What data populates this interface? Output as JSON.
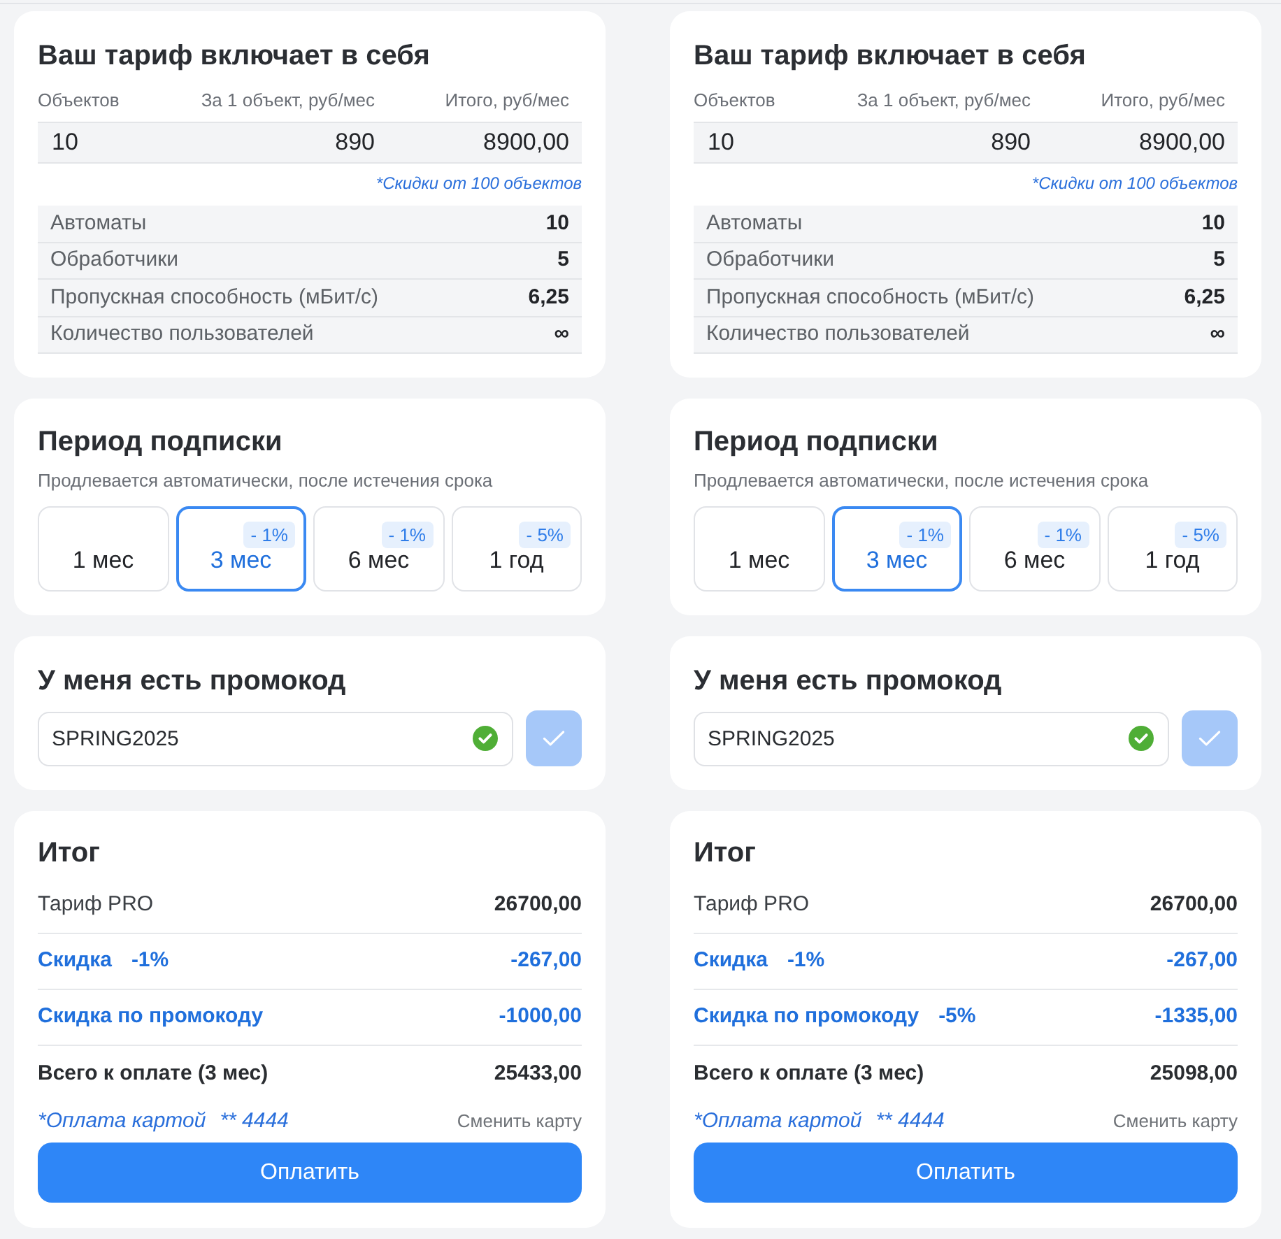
{
  "panels": [
    {
      "tariff": {
        "title": "Ваш тариф включает в себя",
        "columns": [
          "Объектов",
          "За 1 объект, руб/мес",
          "Итого, руб/мес"
        ],
        "values": [
          "10",
          "890",
          "8900,00"
        ],
        "note": "*Скидки от 100 объектов",
        "features": [
          {
            "label": "Автоматы",
            "value": "10"
          },
          {
            "label": "Обработчики",
            "value": "5"
          },
          {
            "label": "Пропускная способность (мБит/с)",
            "value": "6,25"
          },
          {
            "label": "Количество пользователей",
            "value": "∞"
          }
        ]
      },
      "period": {
        "title": "Период подписки",
        "subtitle": "Продлевается автоматически, после истечения срока",
        "options": [
          {
            "label": "1 мес",
            "selected": false
          },
          {
            "label": "3 мес",
            "discount": "- 1%",
            "selected": true
          },
          {
            "label": "6 мес",
            "discount": "- 1%",
            "selected": false
          },
          {
            "label": "1 год",
            "discount": "- 5%",
            "selected": false
          }
        ]
      },
      "promo": {
        "title": "У меня есть промокод",
        "value": "SPRING2025",
        "valid": true,
        "apply_disabled": true
      },
      "summary": {
        "title": "Итог",
        "lines": [
          {
            "kind": "base",
            "label": "Тариф PRO",
            "amount": "26700,00"
          },
          {
            "kind": "discount",
            "label": "Скидка",
            "percent": "-1%",
            "amount": "-267,00"
          },
          {
            "kind": "discount",
            "label": "Скидка по промокоду",
            "amount": "-1000,00"
          },
          {
            "kind": "total",
            "label": "Всего к оплате (3 мес)",
            "amount": "25433,00"
          }
        ],
        "payment_method": "*Оплата картой",
        "card_mask": "** 4444",
        "change_card": "Сменить карту",
        "pay_button": "Оплатить"
      }
    },
    {
      "tariff": {
        "title": "Ваш тариф включает в себя",
        "columns": [
          "Объектов",
          "За 1 объект, руб/мес",
          "Итого, руб/мес"
        ],
        "values": [
          "10",
          "890",
          "8900,00"
        ],
        "note": "*Скидки от 100 объектов",
        "features": [
          {
            "label": "Автоматы",
            "value": "10"
          },
          {
            "label": "Обработчики",
            "value": "5"
          },
          {
            "label": "Пропускная способность (мБит/с)",
            "value": "6,25"
          },
          {
            "label": "Количество пользователей",
            "value": "∞"
          }
        ]
      },
      "period": {
        "title": "Период подписки",
        "subtitle": "Продлевается автоматически, после истечения срока",
        "options": [
          {
            "label": "1 мес",
            "selected": false
          },
          {
            "label": "3 мес",
            "discount": "- 1%",
            "selected": true
          },
          {
            "label": "6 мес",
            "discount": "- 1%",
            "selected": false
          },
          {
            "label": "1 год",
            "discount": "- 5%",
            "selected": false
          }
        ]
      },
      "promo": {
        "title": "У меня есть промокод",
        "value": "SPRING2025",
        "valid": true,
        "apply_disabled": true
      },
      "summary": {
        "title": "Итог",
        "lines": [
          {
            "kind": "base",
            "label": "Тариф PRO",
            "amount": "26700,00"
          },
          {
            "kind": "discount",
            "label": "Скидка",
            "percent": "-1%",
            "amount": "-267,00"
          },
          {
            "kind": "discount",
            "label": "Скидка по промокоду",
            "percent": "-5%",
            "amount": "-1335,00"
          },
          {
            "kind": "total",
            "label": "Всего к оплате (3 мес)",
            "amount": "25098,00"
          }
        ],
        "payment_method": "*Оплата картой",
        "card_mask": "** 4444",
        "change_card": "Сменить карту",
        "pay_button": "Оплатить"
      }
    }
  ]
}
